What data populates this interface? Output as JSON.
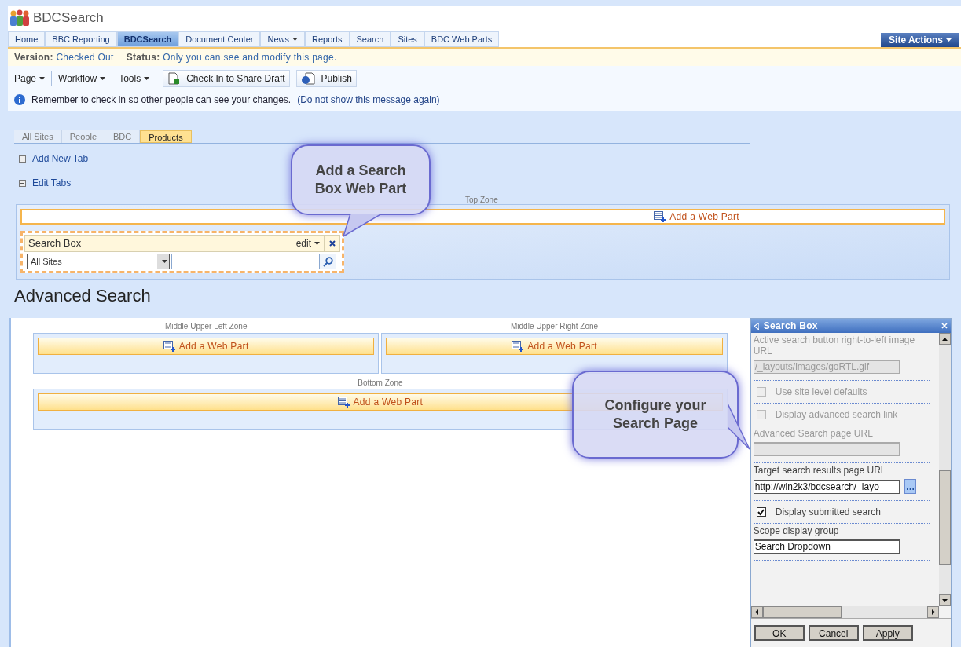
{
  "site": {
    "title": "BDCSearch",
    "site_actions": "Site Actions"
  },
  "nav_tabs": [
    {
      "label": "Home",
      "selected": false,
      "dropdown": false
    },
    {
      "label": "BBC Reporting",
      "selected": false,
      "dropdown": false
    },
    {
      "label": "BDCSearch",
      "selected": true,
      "dropdown": false
    },
    {
      "label": "Document Center",
      "selected": false,
      "dropdown": false
    },
    {
      "label": "News",
      "selected": false,
      "dropdown": true
    },
    {
      "label": "Reports",
      "selected": false,
      "dropdown": false
    },
    {
      "label": "Search",
      "selected": false,
      "dropdown": false
    },
    {
      "label": "Sites",
      "selected": false,
      "dropdown": false
    },
    {
      "label": "BDC Web Parts",
      "selected": false,
      "dropdown": false
    }
  ],
  "version_bar": {
    "version_label": "Version:",
    "version_value": "Checked Out",
    "status_label": "Status:",
    "status_value": "Only you can see and modify this page."
  },
  "toolbar": {
    "menus": [
      "Page",
      "Workflow",
      "Tools"
    ],
    "buttons": [
      {
        "label": "Check In to Share Draft",
        "kind": "checkin"
      },
      {
        "label": "Publish",
        "kind": "publish"
      }
    ]
  },
  "message": {
    "text": "Remember to check in so other people can see your changes.",
    "link": "(Do not show this message again)"
  },
  "search_tabs": [
    {
      "label": "All Sites",
      "selected": false
    },
    {
      "label": "People",
      "selected": false
    },
    {
      "label": "BDC",
      "selected": false
    },
    {
      "label": "Products",
      "selected": true
    }
  ],
  "tab_links": [
    "Add New Tab",
    "Edit Tabs"
  ],
  "top_zone": {
    "label": "Top Zone",
    "add": "Add a Web Part"
  },
  "search_box_part": {
    "title": "Search Box",
    "edit": "edit",
    "scope": "All Sites"
  },
  "page_heading": "Advanced Search",
  "middle_zones": [
    {
      "label": "Middle Upper Left Zone",
      "add": "Add a Web Part"
    },
    {
      "label": "Middle Upper Right Zone",
      "add": "Add a Web Part"
    }
  ],
  "bottom_zone": {
    "label": "Bottom Zone",
    "add": "Add a Web Part"
  },
  "callouts": [
    {
      "text": "Add a Search Box Web Part"
    },
    {
      "text": "Configure your Search Page"
    }
  ],
  "tool_pane": {
    "title": "Search Box",
    "items": [
      {
        "kind": "field",
        "label": "Active search button right-to-left image URL",
        "value": "/_layouts/images/goRTL.gif",
        "disabled": true
      },
      {
        "kind": "checkbox",
        "label": "Use site level defaults",
        "checked": false,
        "disabled": true
      },
      {
        "kind": "checkbox",
        "label": "Display advanced search link",
        "checked": false,
        "disabled": true
      },
      {
        "kind": "field",
        "label": "Advanced Search page URL",
        "value": "",
        "disabled": true
      },
      {
        "kind": "browse_field",
        "label": "Target search results page URL",
        "value": "http://win2k3/bdcsearch/_layo",
        "disabled": false
      },
      {
        "kind": "checkbox",
        "label": "Display submitted search",
        "checked": true,
        "disabled": false
      },
      {
        "kind": "field",
        "label": "Scope display group",
        "value": "Search Dropdown",
        "disabled": false
      }
    ],
    "buttons": [
      "OK",
      "Cancel",
      "Apply"
    ]
  }
}
